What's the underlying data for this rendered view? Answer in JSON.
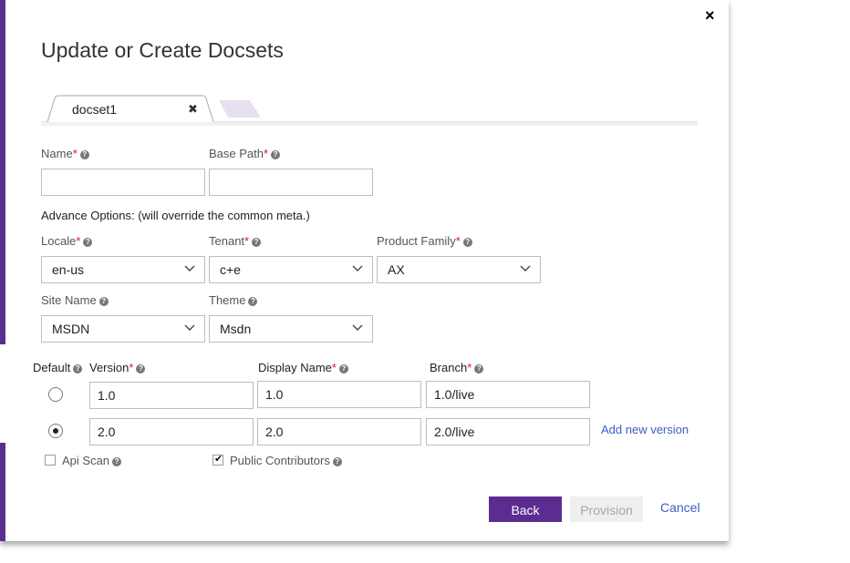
{
  "background": {
    "fragment": "1030"
  },
  "dialog": {
    "title": "Update or Create Docsets",
    "close_glyph": "×",
    "accent_color": "#5c2d91",
    "link_color": "#3b5ec4"
  },
  "tabs": [
    {
      "label": "docset1",
      "close_glyph": "✖",
      "active": true
    },
    {
      "label": "",
      "active": false
    }
  ],
  "form": {
    "name": {
      "label": "Name",
      "required_mark": "*",
      "value": ""
    },
    "base_path": {
      "label": "Base Path",
      "required_mark": "*",
      "value": ""
    },
    "advance_options_text": "Advance Options: (will override the common meta.)",
    "locale": {
      "label": "Locale",
      "required_mark": "*",
      "value": "en-us"
    },
    "tenant": {
      "label": "Tenant",
      "required_mark": "*",
      "value": "c+e"
    },
    "product_family": {
      "label": "Product Family",
      "required_mark": "*",
      "value": "AX"
    },
    "site_name": {
      "label": "Site Name",
      "value": "MSDN"
    },
    "theme": {
      "label": "Theme",
      "value": "Msdn"
    }
  },
  "versions": {
    "headers": {
      "default": "Default",
      "version": "Version",
      "display_name": "Display Name",
      "branch": "Branch",
      "required_mark": "*"
    },
    "rows": [
      {
        "selected": false,
        "version": "1.0",
        "display_name": "1.0",
        "branch": "1.0/live"
      },
      {
        "selected": true,
        "version": "2.0",
        "display_name": "2.0",
        "branch": "2.0/live"
      }
    ],
    "add_new_label": "Add new version"
  },
  "options": {
    "api_scan": {
      "label": "Api Scan",
      "checked": false
    },
    "public_contributors": {
      "label": "Public Contributors",
      "checked": true
    }
  },
  "actions": {
    "back": "Back",
    "provision": "Provision",
    "cancel": "Cancel"
  },
  "icons": {
    "help": "help-circle-icon",
    "dropdown": "chevron-down-icon",
    "check": "check-icon",
    "close": "close-icon"
  }
}
